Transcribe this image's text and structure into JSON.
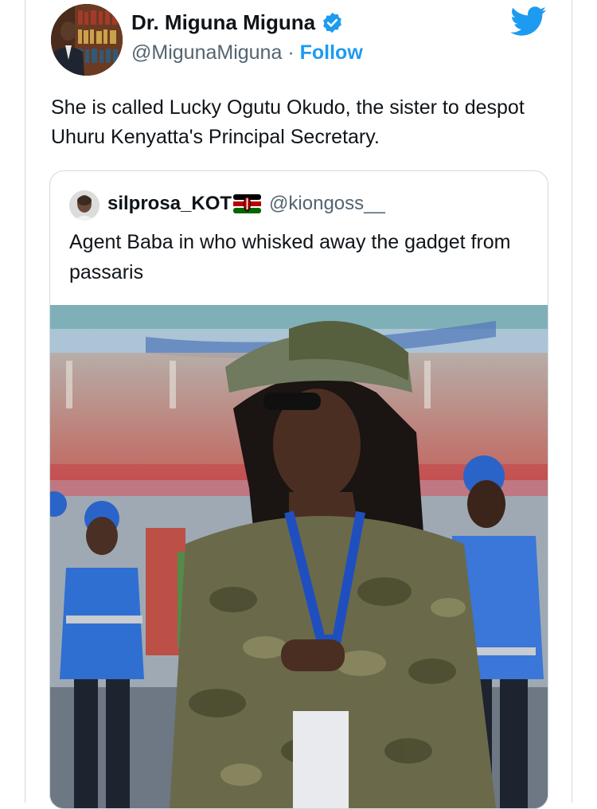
{
  "author": {
    "name": "Dr. Miguna Miguna",
    "handle": "@MigunaMiguna",
    "separator": "·",
    "follow_label": "Follow"
  },
  "tweet": {
    "text": "She is called Lucky Ogutu Okudo, the sister to despot Uhuru Kenyatta's Principal Secretary."
  },
  "quoted": {
    "name": "silprosa_KOT",
    "handle": "@kiongoss__",
    "text": "Agent Baba in  who whisked away the gadget from passaris"
  },
  "icons": {
    "verified": "verified-badge-icon",
    "brand": "twitter-bird-icon",
    "flag": "kenya-flag-emoji"
  },
  "colors": {
    "accent": "#1d9bf0",
    "text": "#0f1419",
    "secondary": "#536471",
    "border": "#cfd9de"
  }
}
